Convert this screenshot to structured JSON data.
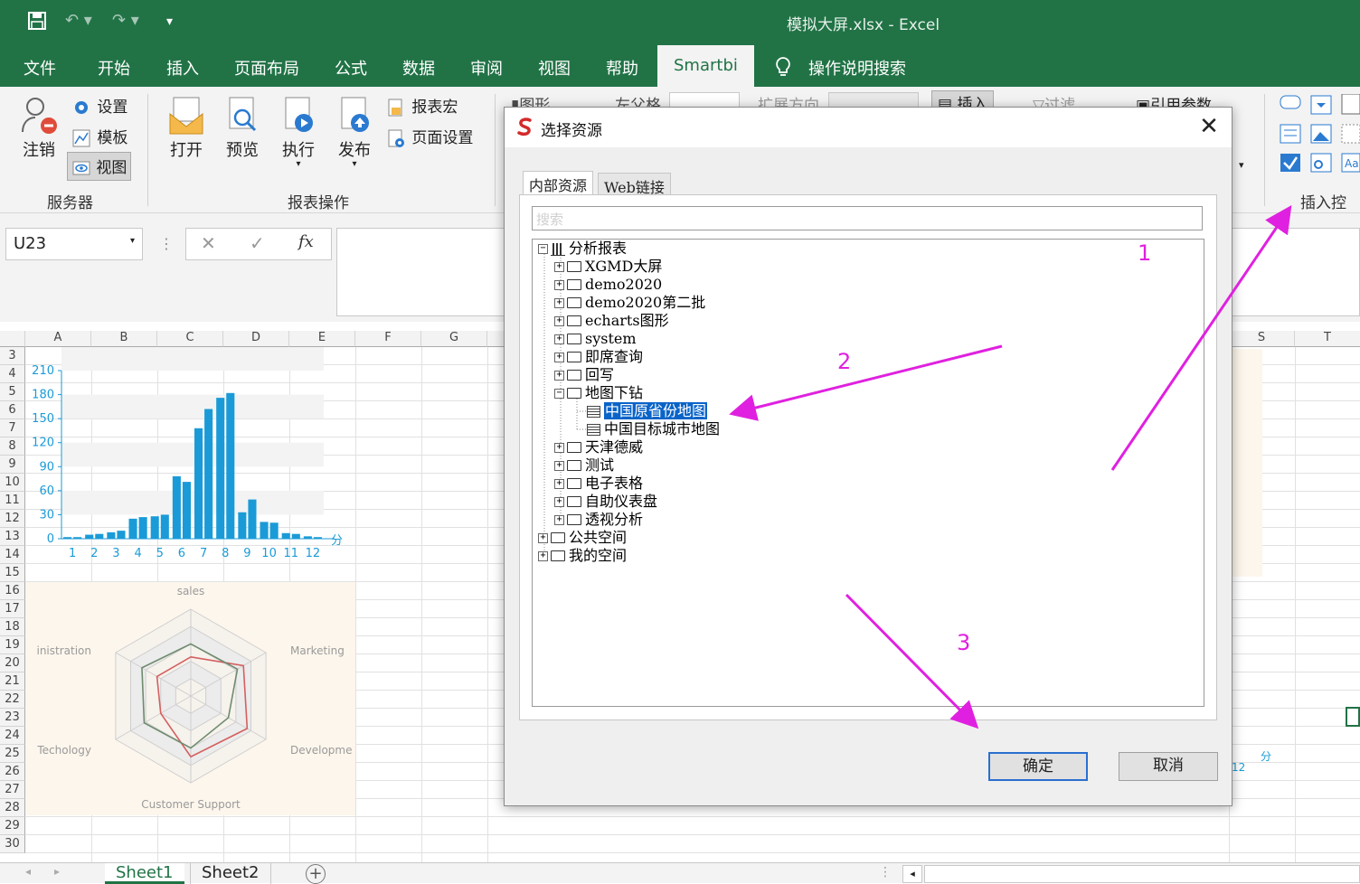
{
  "titlebar": {
    "doc_title": "模拟大屏.xlsx  -  Excel"
  },
  "menu": {
    "tabs": [
      "文件",
      "开始",
      "插入",
      "页面布局",
      "公式",
      "数据",
      "审阅",
      "视图",
      "帮助",
      "Smartbi"
    ],
    "tell_me": "操作说明搜索"
  },
  "ribbon": {
    "logout": "注销",
    "settings": "设置",
    "template": "模板",
    "view": "视图",
    "server_group": "服务器",
    "open": "打开",
    "preview": "预览",
    "execute": "执行",
    "publish": "发布",
    "report_macro": "报表宏",
    "page_setup": "页面设置",
    "report_ops_group": "报表操作",
    "insert_controls_group": "插入控件",
    "partial_graph": "图形",
    "partial_left_grid": "左父格",
    "partial_expand": "扩展方向",
    "partial_insert": "插入",
    "partial_filter": "过滤",
    "partial_ref_param": "引用参数"
  },
  "formula": {
    "name_box": "U23",
    "cancel": "✕",
    "enter": "✓",
    "fx": "fx"
  },
  "grid": {
    "columns": [
      "A",
      "B",
      "C",
      "D",
      "E",
      "F",
      "G",
      "S",
      "T"
    ],
    "rows": [
      "3",
      "4",
      "5",
      "6",
      "7",
      "8",
      "9",
      "10",
      "11",
      "12",
      "13",
      "14",
      "15",
      "16",
      "17",
      "18",
      "19",
      "20",
      "21",
      "22",
      "23",
      "24",
      "25",
      "26",
      "27",
      "28",
      "29",
      "30"
    ]
  },
  "chart_data": [
    {
      "type": "bar",
      "categories": [
        "1",
        "2",
        "3",
        "4",
        "5",
        "6",
        "7",
        "8",
        "9",
        "10",
        "11",
        "12"
      ],
      "series": [
        {
          "values": [
            2,
            5,
            8,
            25,
            28,
            78,
            138,
            176,
            33,
            21,
            7,
            3
          ]
        },
        {
          "values": [
            2,
            6,
            10,
            27,
            30,
            71,
            162,
            182,
            49,
            20,
            6,
            2
          ]
        }
      ],
      "yticks": [
        "0",
        "30",
        "60",
        "90",
        "120",
        "150",
        "180",
        "210"
      ],
      "ylim": [
        0,
        210
      ],
      "ylabel": "",
      "xlabel": "分",
      "color": "#1a9bd7"
    },
    {
      "type": "radar",
      "axes": [
        "sales",
        "Marketing",
        "Developme",
        "Customer Support",
        "Techology",
        "inistration"
      ],
      "series": [
        {
          "color": "#d46060",
          "values": [
            0.45,
            0.7,
            0.75,
            0.7,
            0.4,
            0.45
          ]
        },
        {
          "color": "#6f8b6f",
          "values": [
            0.6,
            0.62,
            0.5,
            0.6,
            0.62,
            0.65
          ]
        }
      ]
    }
  ],
  "dialog": {
    "title": "选择资源",
    "tabs": [
      "内部资源",
      "Web链接"
    ],
    "search_placeholder": "搜索",
    "tree": {
      "root": "分析报表",
      "items": [
        "XGMD大屏",
        "demo2020",
        "demo2020第二批",
        "echarts图形",
        "system",
        "即席查询",
        "回写",
        "地图下钻",
        "中国原省份地图",
        "中国目标城市地图",
        "天津德威",
        "测试",
        "电子表格",
        "自助仪表盘",
        "透视分析"
      ],
      "public": "公共空间",
      "mine": "我的空间"
    },
    "ok": "确定",
    "cancel": "取消"
  },
  "annotations": [
    "1",
    "2",
    "3"
  ],
  "sheets": [
    "Sheet1",
    "Sheet2"
  ],
  "background_chart_fragments": {
    "tick": "12",
    "unit": "分"
  }
}
